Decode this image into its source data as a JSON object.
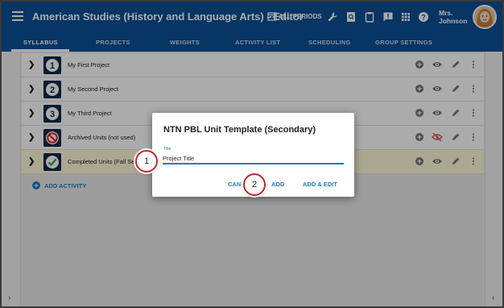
{
  "header": {
    "title": "American Studies (History and Language Arts) - Editor",
    "periods_label": "ALL PERIODS",
    "user_name_line1": "Mrs.",
    "user_name_line2": "Johnson",
    "icons": [
      "menu-icon",
      "calendar-icon",
      "wrench-icon",
      "search-doc-icon",
      "clipboard-icon",
      "feedback-icon",
      "apps-grid-icon",
      "help-icon"
    ]
  },
  "tabs": [
    {
      "label": "SYLLABUS",
      "active": true
    },
    {
      "label": "PROJECTS",
      "active": false
    },
    {
      "label": "WEIGHTS",
      "active": false
    },
    {
      "label": "ACTIVITY LIST",
      "active": false
    },
    {
      "label": "SCHEDULING",
      "active": false
    },
    {
      "label": "GROUP SETTINGS",
      "active": false
    }
  ],
  "rows": [
    {
      "icon": "number-1-icon",
      "glyph": "1",
      "label": "My First Project",
      "visible": true
    },
    {
      "icon": "number-2-icon",
      "glyph": "2",
      "label": "My Second Project",
      "visible": true
    },
    {
      "icon": "number-3-icon",
      "glyph": "3",
      "label": "My Third Project",
      "visible": true
    },
    {
      "icon": "no-entry-icon",
      "glyph": "",
      "label": "Archived Units (not used)",
      "visible": false
    },
    {
      "icon": "checkmark-icon",
      "glyph": "",
      "label": "Completed Units (Fall Se",
      "visible": true,
      "highlight": true
    }
  ],
  "add_activity_label": "ADD ACTIVITY",
  "dialog": {
    "title": "NTN PBL Unit Template (Secondary)",
    "field_label": "Title",
    "field_value": "Project Title",
    "cancel_label": "CAN",
    "add_label": "ADD",
    "add_edit_label": "ADD & EDIT"
  },
  "callouts": [
    "1",
    "2"
  ],
  "colors": {
    "header_blue": "#0b5096",
    "accent_blue": "#1e7ac9",
    "callout_red": "#c0282e",
    "highlight_yellow": "#fffbd8",
    "hidden_red": "#d9534f"
  }
}
